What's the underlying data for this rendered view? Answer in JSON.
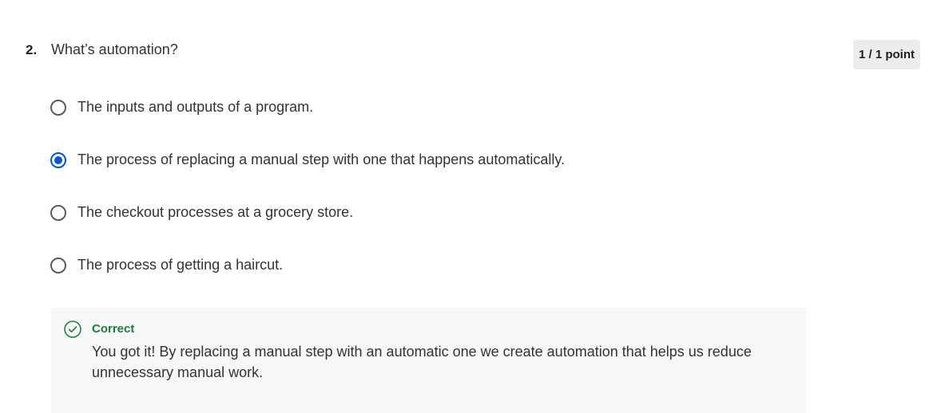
{
  "question": {
    "number": "2.",
    "text": "What’s automation?",
    "points": "1 / 1 point"
  },
  "options": [
    {
      "label": "The inputs and outputs of a program.",
      "selected": false
    },
    {
      "label": "The process of replacing a manual step with one that happens automatically.",
      "selected": true
    },
    {
      "label": "The checkout processes at a grocery store.",
      "selected": false
    },
    {
      "label": "The process of getting a haircut.",
      "selected": false
    }
  ],
  "feedback": {
    "icon": "check-circle-icon",
    "title": "Correct",
    "text": "You got it! By replacing a manual step with an automatic one we create automation that helps us reduce unnecessary manual work."
  },
  "colors": {
    "accent": "#0056d2",
    "correct": "#1f7a3f",
    "feedback_bg": "#f5f8f7",
    "badge_bg": "#ececec"
  }
}
